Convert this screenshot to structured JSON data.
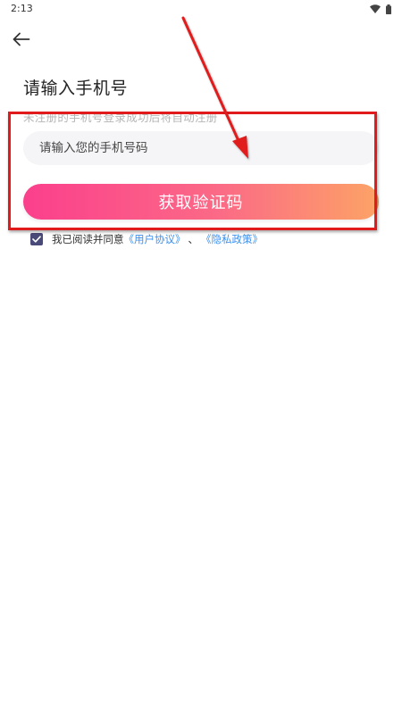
{
  "status_bar": {
    "time": "2:13",
    "icons": [
      "wifi-icon",
      "battery-icon"
    ]
  },
  "header": {
    "back_icon": "arrow-left-icon"
  },
  "login": {
    "title": "请输入手机号",
    "subtitle": "未注册的手机号登录成功后将自动注册",
    "phone_placeholder": "请输入您的手机号码",
    "phone_value": "",
    "submit_label": "获取验证码"
  },
  "agreement": {
    "checked": true,
    "prefix": "我已阅读并同意",
    "user_agreement": "《用户协议》",
    "separator": "、",
    "privacy_policy": "《隐私政策》"
  },
  "colors": {
    "gradient_start": "#fb3f8c",
    "gradient_end": "#fca366",
    "link": "#3a8ff0",
    "checkbox": "#4a4a78",
    "annotation": "#e11b1b"
  }
}
